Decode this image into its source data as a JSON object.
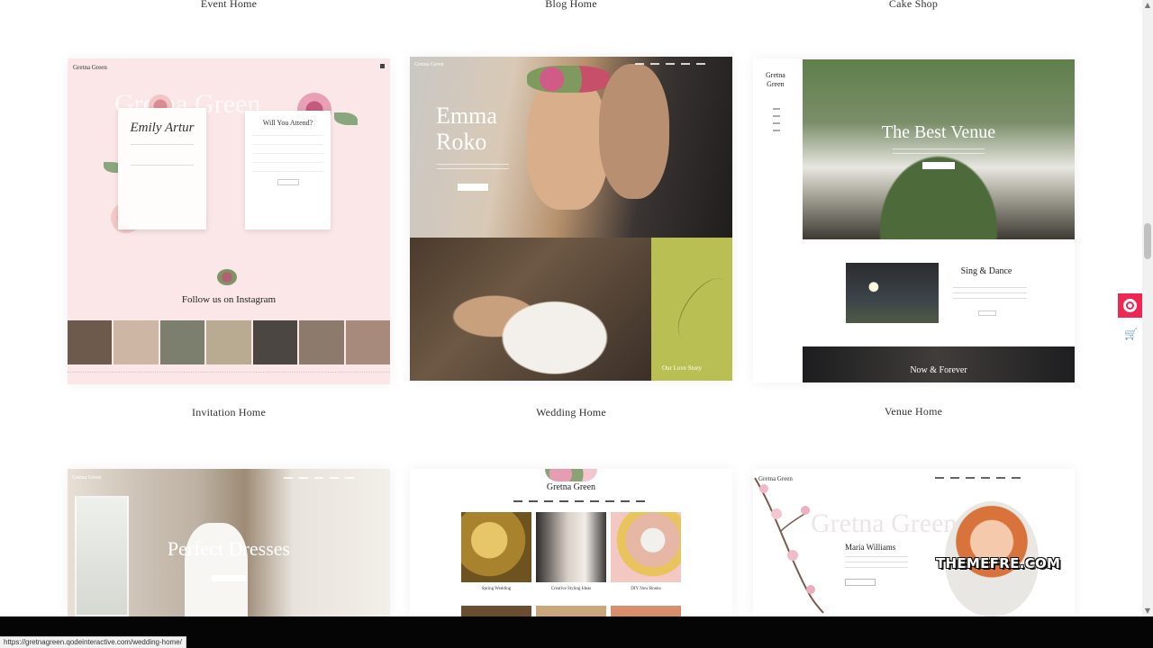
{
  "top_captions": [
    "Event Home",
    "Blog Home",
    "Cake Shop"
  ],
  "demos_row1": [
    {
      "caption": "Invitation Home",
      "logo": "Gretna Green",
      "ghost_title": "Gretna Green",
      "names": "Emily Artur",
      "form_title": "Will You Attend?",
      "follow": "Follow us on Instagram"
    },
    {
      "caption": "Wedding Home",
      "logo": "Gretna Green",
      "hero_name_1": "Emma",
      "hero_name_2": "Roko",
      "story": "Our Love Story"
    },
    {
      "caption": "Venue Home",
      "logo_1": "Gretna",
      "logo_2": "Green",
      "hero_title": "The Best Venue",
      "section_title": "Sing & Dance",
      "band_title": "Now & Forever"
    }
  ],
  "demos_row2": [
    {
      "logo": "Gretna Green",
      "hero_title": "Perfect Dresses"
    },
    {
      "logo": "Gretna Green",
      "tiles": [
        "Spring Wedding",
        "Creative Styling Ideas",
        "DIY New Books"
      ]
    },
    {
      "logo": "Gretna Green",
      "ghost_title": "Gretna Green",
      "person": "Maria Williams"
    }
  ],
  "watermark": "THEMEFRE.COM",
  "status_url": "https://gretnagreen.qodeinteractive.com/wedding-home/",
  "colors": {
    "accent": "#ee2852",
    "invite_bg": "#fbe7e7",
    "olive": "#b9bf52"
  },
  "icons": {
    "widget": "circle-target-icon",
    "cart": "shopping-cart-icon"
  }
}
